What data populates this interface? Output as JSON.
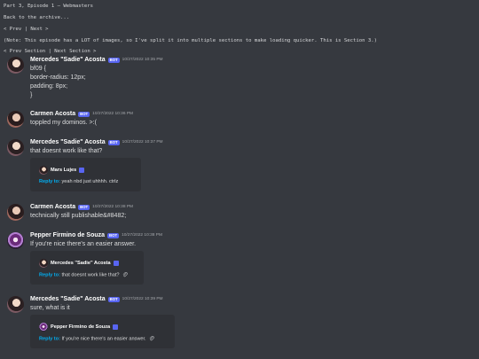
{
  "header": {
    "title": "Part 3, Episode 1 — Webmasters",
    "back": "Back to the archive...",
    "prev": "< Prev",
    "sep": "|",
    "next": "Next >",
    "note": "(Note: This episode has a LOT of images, so I've split it into multiple sections to make loading quicker. This is Section 3.)",
    "prev_section": "< Prev Section",
    "next_section": "Next Section >"
  },
  "bot_label": "BOT",
  "messages": [
    {
      "author": "Mercedes \"Sadie\" Acosta",
      "time": "10/27/2022 10:35 PM",
      "lines": [
        "bf09 {",
        "border-radius: 12px;",
        "padding: 8px;",
        "}"
      ]
    },
    {
      "author": "Carmen Acosta",
      "time": "10/27/2022 10:36 PM",
      "lines": [
        "toppled my dominos. >:("
      ]
    },
    {
      "author": "Mercedes \"Sadie\" Acosta",
      "time": "10/27/2022 10:37 PM",
      "lines": [
        "that doesnt work like that?"
      ],
      "embed": {
        "author": "Mars Lujes",
        "reply_label": "Reply to:",
        "reply_text": "yeah nbd just uhhhh. ctrlz"
      }
    },
    {
      "author": "Carmen Acosta",
      "time": "10/27/2022 10:38 PM",
      "lines": [
        "technically still publishable&#8482;"
      ]
    },
    {
      "author": "Pepper Firmino de Souza",
      "time": "10/27/2022 10:38 PM",
      "lines": [
        "If you're nice there's an easier answer."
      ],
      "embed": {
        "author": "Mercedes \"Sadie\" Acosta",
        "reply_label": "Reply to:",
        "reply_text": "that doesnt work like that?"
      }
    },
    {
      "author": "Mercedes \"Sadie\" Acosta",
      "time": "10/27/2022 10:39 PM",
      "lines": [
        "sure, what is it"
      ],
      "embed": {
        "author": "Pepper Firmino de Souza",
        "reply_label": "Reply to:",
        "reply_text": "If you're nice there's an easier answer."
      }
    }
  ],
  "icons": {
    "attachment": "paperclip-icon",
    "verified": "verified-badge-icon"
  }
}
